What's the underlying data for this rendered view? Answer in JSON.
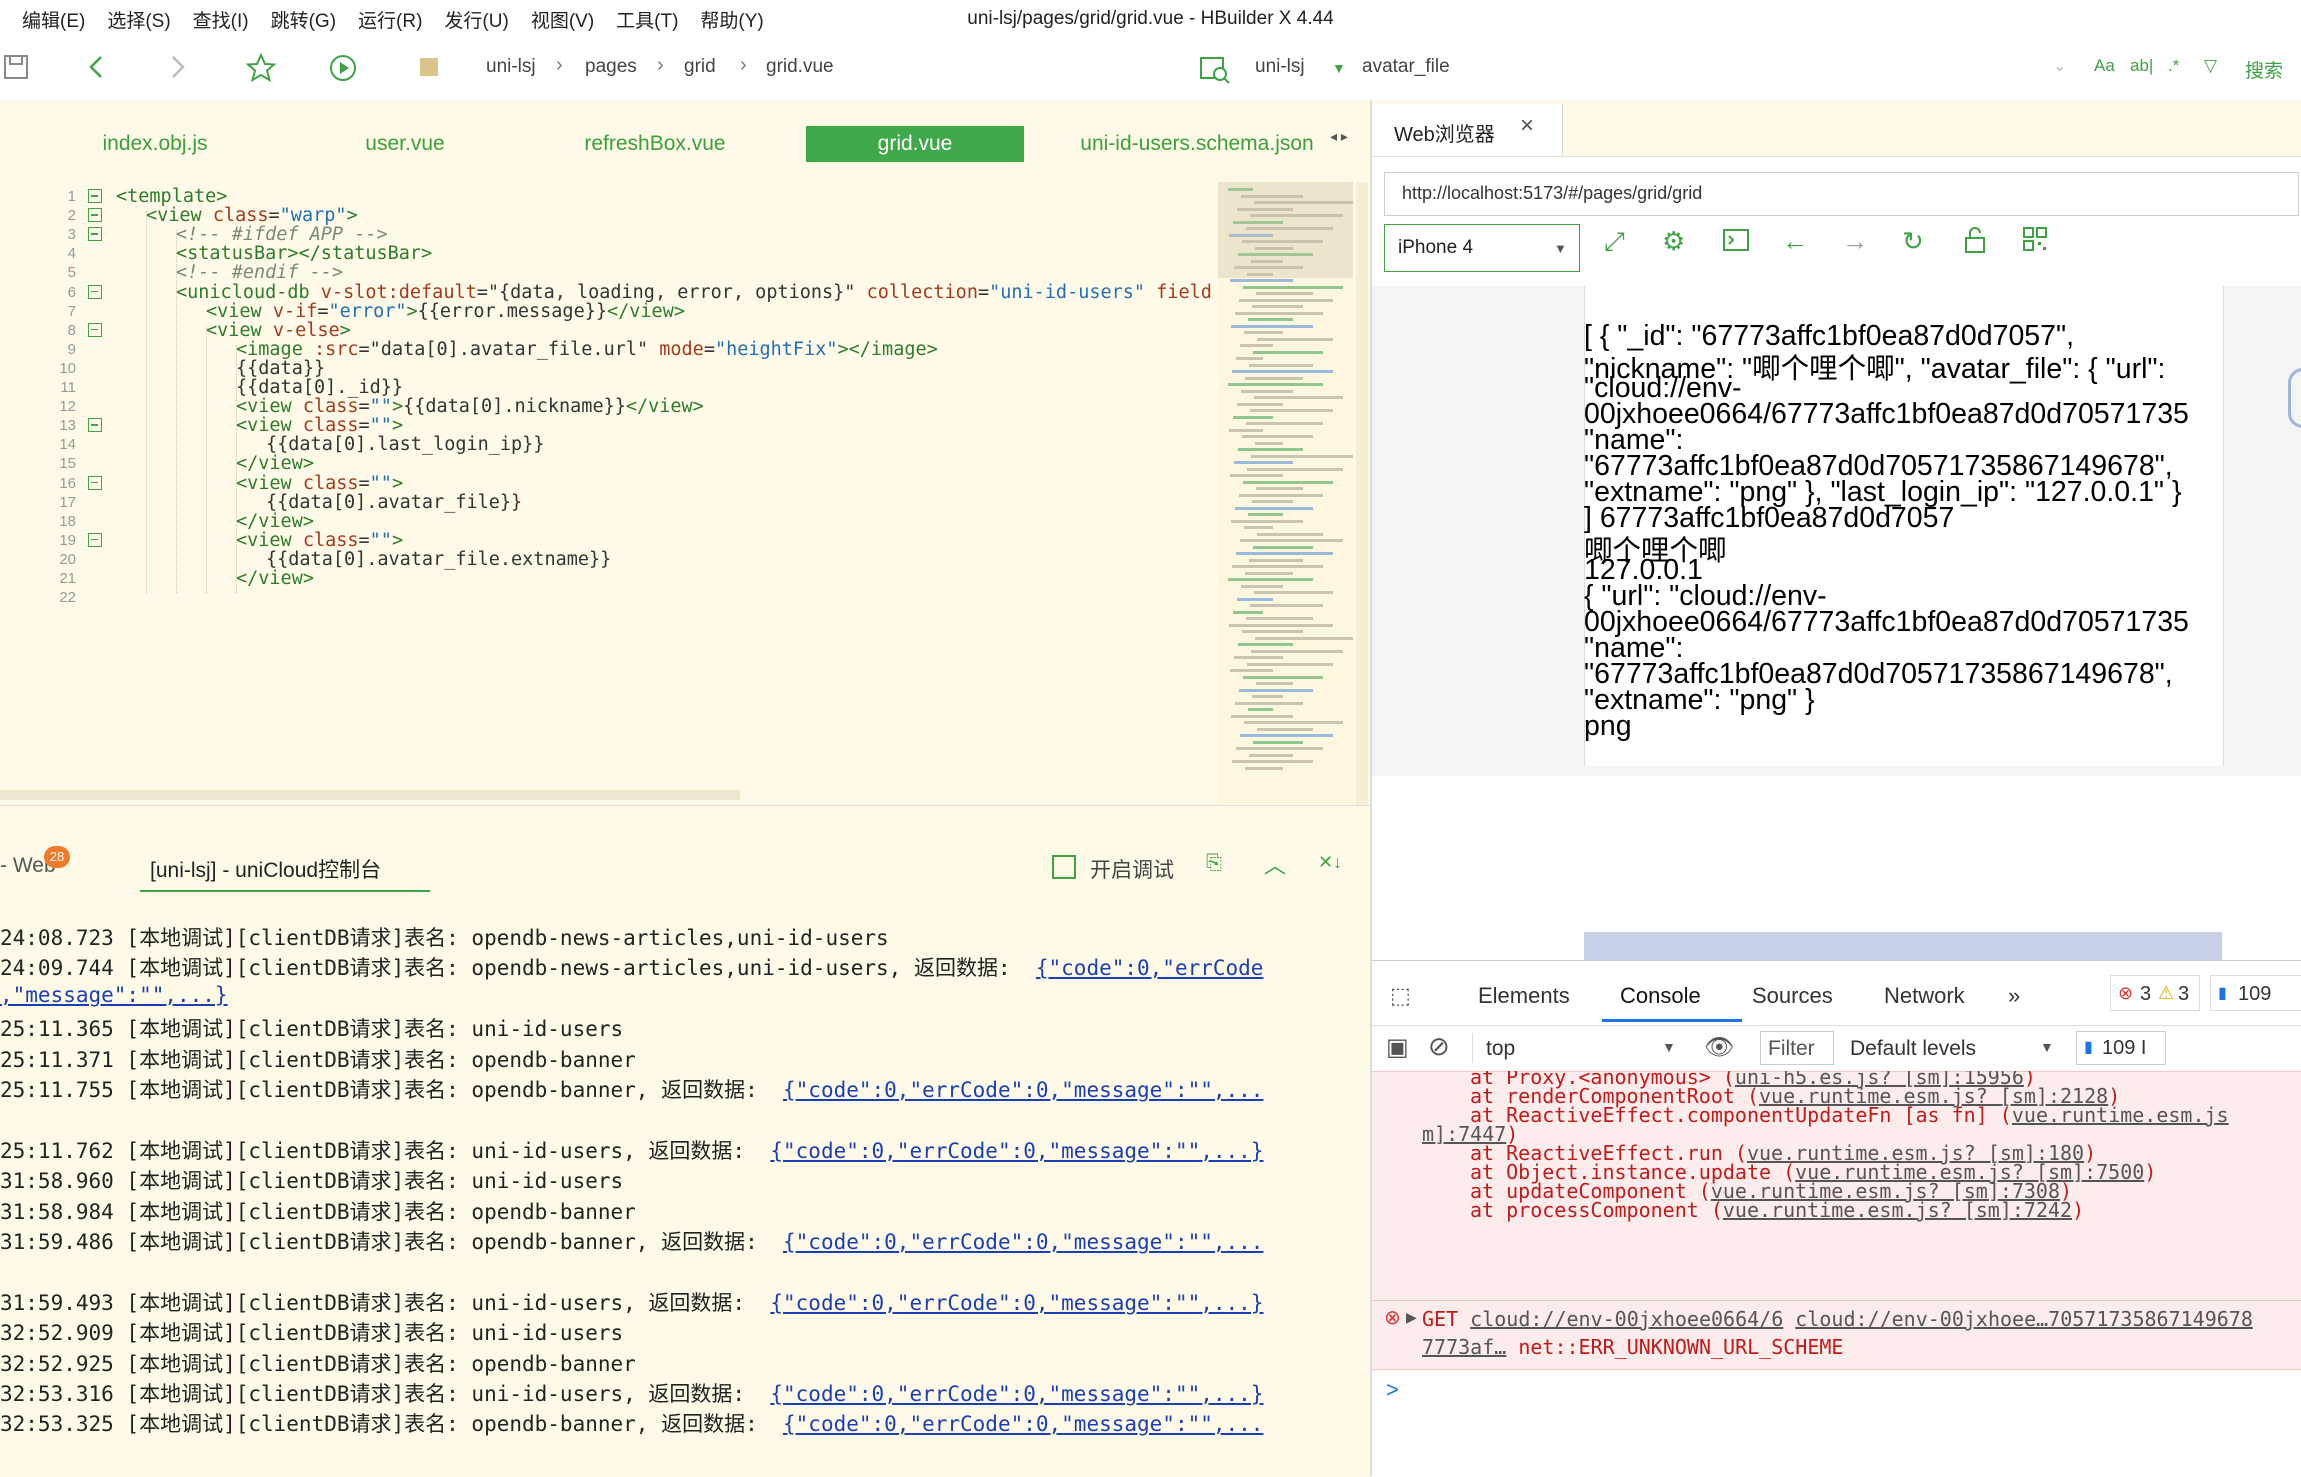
{
  "menubar": {
    "items": [
      "编辑(E)",
      "选择(S)",
      "查找(I)",
      "跳转(G)",
      "运行(R)",
      "发行(U)",
      "视图(V)",
      "工具(T)",
      "帮助(Y)"
    ],
    "title": "uni-lsj/pages/grid/grid.vue - HBuilder X 4.44"
  },
  "toolbar": {
    "breadcrumb": [
      "uni-lsj",
      "pages",
      "grid",
      "grid.vue"
    ],
    "project": "uni-lsj",
    "field": "avatar_file",
    "search_label": "搜索",
    "search_tools": [
      "Aa",
      "ab|",
      ".*"
    ]
  },
  "editor": {
    "tabs": [
      "index.obj.js",
      "user.vue",
      "refreshBox.vue",
      "grid.vue",
      "uni-id-users.schema.json"
    ],
    "active_tab": "grid.vue",
    "lines": [
      [
        [
          "tag",
          "<template>"
        ]
      ],
      [
        [
          "tag",
          "<view "
        ],
        [
          "attr",
          "class"
        ],
        [
          "txt",
          "="
        ],
        [
          "str",
          "\"warp\""
        ],
        [
          "tag",
          ">"
        ]
      ],
      [
        [
          "cmt",
          "<!-- #ifdef APP -->"
        ]
      ],
      [
        [
          "tag",
          "<statusBar></statusBar>"
        ]
      ],
      [
        [
          "cmt",
          "<!-- #endif -->"
        ]
      ],
      [
        [
          "tag",
          "<unicloud-db "
        ],
        [
          "attr",
          "v-slot:default"
        ],
        [
          "txt",
          "="
        ],
        [
          "txt",
          "\"{data, loading, error, options}\" "
        ],
        [
          "attr",
          "collection"
        ],
        [
          "txt",
          "="
        ],
        [
          "str",
          "\"uni-id-users\" "
        ],
        [
          "attr",
          "field"
        ]
      ],
      [
        [
          "tag",
          "<view "
        ],
        [
          "attr",
          "v-if"
        ],
        [
          "txt",
          "="
        ],
        [
          "str",
          "\"error\""
        ],
        [
          "tag",
          ">"
        ],
        [
          "txt",
          "{{error.message}}"
        ],
        [
          "tag",
          "</view>"
        ]
      ],
      [
        [
          "tag",
          "<view "
        ],
        [
          "attr",
          "v-else"
        ],
        [
          "tag",
          ">"
        ]
      ],
      [
        [
          "tag",
          "<image "
        ],
        [
          "attr",
          ":src"
        ],
        [
          "txt",
          "=\"data[0].avatar_file.url\" "
        ],
        [
          "attr",
          "mode"
        ],
        [
          "txt",
          "="
        ],
        [
          "str",
          "\"heightFix\""
        ],
        [
          "tag",
          "></image>"
        ]
      ],
      [
        [
          "txt",
          "{{data}}"
        ]
      ],
      [
        [
          "txt",
          "{{data[0]._id}}"
        ]
      ],
      [
        [
          "tag",
          "<view "
        ],
        [
          "attr",
          "class"
        ],
        [
          "txt",
          "="
        ],
        [
          "str",
          "\"\""
        ],
        [
          "tag",
          ">"
        ],
        [
          "txt",
          "{{data[0].nickname}}"
        ],
        [
          "tag",
          "</view>"
        ]
      ],
      [
        [
          "tag",
          "<view "
        ],
        [
          "attr",
          "class"
        ],
        [
          "txt",
          "="
        ],
        [
          "str",
          "\"\""
        ],
        [
          "tag",
          ">"
        ]
      ],
      [
        [
          "txt",
          "{{data[0].last_login_ip}}"
        ]
      ],
      [
        [
          "tag",
          "</view>"
        ]
      ],
      [
        [
          "tag",
          "<view "
        ],
        [
          "attr",
          "class"
        ],
        [
          "txt",
          "="
        ],
        [
          "str",
          "\"\""
        ],
        [
          "tag",
          ">"
        ]
      ],
      [
        [
          "txt",
          "{{data[0].avatar_file}}"
        ]
      ],
      [
        [
          "tag",
          "</view>"
        ]
      ],
      [
        [
          "tag",
          "<view "
        ],
        [
          "attr",
          "class"
        ],
        [
          "txt",
          "="
        ],
        [
          "str",
          "\"\""
        ],
        [
          "tag",
          ">"
        ]
      ],
      [
        [
          "txt",
          "{{data[0].avatar_file.extname}}"
        ]
      ],
      [
        [
          "tag",
          "</view>"
        ]
      ],
      []
    ],
    "indents": [
      0,
      1,
      2,
      2,
      2,
      2,
      3,
      3,
      4,
      4,
      4,
      4,
      4,
      5,
      4,
      4,
      5,
      4,
      4,
      5,
      4,
      0
    ],
    "fold_lines": [
      1,
      2,
      3,
      6,
      8,
      13,
      16,
      19
    ],
    "line_numbers": [
      "1",
      "2",
      "3",
      "4",
      "5",
      "6",
      "7",
      "8",
      "9",
      "10",
      "11",
      "12",
      "13",
      "14",
      "15",
      "16",
      "17",
      "18",
      "19",
      "20",
      "21",
      "22"
    ]
  },
  "console": {
    "tab_web": "- Web",
    "badge": "28",
    "tab_active": "[uni-lsj] - uniCloud控制台",
    "debug_label": "开启调试",
    "logs": [
      {
        "text": "24:08.723 [本地调试][clientDB请求]表名: opendb-news-articles,uni-id-users",
        "link": ""
      },
      {
        "text": "24:09.744 [本地调试][clientDB请求]表名: opendb-news-articles,uni-id-users, 返回数据:  ",
        "link": "{\"code\":0,\"errCode"
      },
      {
        "text": "",
        "link": ",\"message\":\"\",...}"
      },
      {
        "text": "25:11.365 [本地调试][clientDB请求]表名: uni-id-users",
        "link": ""
      },
      {
        "text": "25:11.371 [本地调试][clientDB请求]表名: opendb-banner",
        "link": ""
      },
      {
        "text": "25:11.755 [本地调试][clientDB请求]表名: opendb-banner, 返回数据:  ",
        "link": "{\"code\":0,\"errCode\":0,\"message\":\"\",..."
      },
      {
        "text": "",
        "link": ""
      },
      {
        "text": "25:11.762 [本地调试][clientDB请求]表名: uni-id-users, 返回数据:  ",
        "link": "{\"code\":0,\"errCode\":0,\"message\":\"\",...}"
      },
      {
        "text": "31:58.960 [本地调试][clientDB请求]表名: uni-id-users",
        "link": ""
      },
      {
        "text": "31:58.984 [本地调试][clientDB请求]表名: opendb-banner",
        "link": ""
      },
      {
        "text": "31:59.486 [本地调试][clientDB请求]表名: opendb-banner, 返回数据:  ",
        "link": "{\"code\":0,\"errCode\":0,\"message\":\"\",..."
      },
      {
        "text": "",
        "link": ""
      },
      {
        "text": "31:59.493 [本地调试][clientDB请求]表名: uni-id-users, 返回数据:  ",
        "link": "{\"code\":0,\"errCode\":0,\"message\":\"\",...}"
      },
      {
        "text": "32:52.909 [本地调试][clientDB请求]表名: uni-id-users",
        "link": ""
      },
      {
        "text": "32:52.925 [本地调试][clientDB请求]表名: opendb-banner",
        "link": ""
      },
      {
        "text": "32:53.316 [本地调试][clientDB请求]表名: uni-id-users, 返回数据:  ",
        "link": "{\"code\":0,\"errCode\":0,\"message\":\"\",...}"
      },
      {
        "text": "32:53.325 [本地调试][clientDB请求]表名: opendb-banner, 返回数据:  ",
        "link": "{\"code\":0,\"errCode\":0,\"message\":\"\",..."
      }
    ]
  },
  "browser": {
    "tab_label": "Web浏览器",
    "url": "http://localhost:5173/#/pages/grid/grid",
    "device": "iPhone 4",
    "page_lines": [
      "[ { \"_id\": \"67773affc1bf0ea87d0d7057\",",
      "\"nickname\": \"唧个哩个唧\", \"avatar_file\": { \"url\":",
      "\"cloud://env-",
      "00jxhoee0664/67773affc1bf0ea87d0d70571735",
      "\"name\":",
      "\"67773affc1bf0ea87d0d70571735867149678\",",
      "\"extname\": \"png\" }, \"last_login_ip\": \"127.0.0.1\" }",
      "] 67773affc1bf0ea87d0d7057",
      "唧个哩个唧",
      "127.0.0.1",
      "{ \"url\": \"cloud://env-",
      "00jxhoee0664/67773affc1bf0ea87d0d70571735",
      "\"name\":",
      "\"67773affc1bf0ea87d0d70571735867149678\",",
      "\"extname\": \"png\" }",
      "png"
    ]
  },
  "devtools": {
    "tabs": [
      "Elements",
      "Console",
      "Sources",
      "Network"
    ],
    "active_tab": "Console",
    "errors_count": "3",
    "warnings_count": "3",
    "messages_count": "109",
    "context": "top",
    "filter_placeholder": "Filter",
    "levels": "Default levels",
    "issues_count": "109 I",
    "stack": [
      {
        "prefix": "at Proxy.<anonymous> (",
        "link": "uni-h5.es.js? [sm]:15956",
        "suffix": ")"
      },
      {
        "prefix": "at renderComponentRoot (",
        "link": "vue.runtime.esm.js? [sm]:2128",
        "suffix": ")"
      },
      {
        "prefix": "at ReactiveEffect.componentUpdateFn [as fn] (",
        "link": "vue.runtime.esm.js",
        "suffix": ""
      },
      {
        "prefix": "",
        "link": "m]:7447",
        "suffix": ")"
      },
      {
        "prefix": "at ReactiveEffect.run (",
        "link": "vue.runtime.esm.js? [sm]:180",
        "suffix": ")"
      },
      {
        "prefix": "at Object.instance.update (",
        "link": "vue.runtime.esm.js? [sm]:7500",
        "suffix": ")"
      },
      {
        "prefix": "at updateComponent (",
        "link": "vue.runtime.esm.js? [sm]:7308",
        "suffix": ")"
      },
      {
        "prefix": "at processComponent (",
        "link": "vue.runtime.esm.js? [sm]:7242",
        "suffix": ")"
      }
    ],
    "error2_line1_prefix": "GET ",
    "error2_line1_link1": "cloud://env-00jxhoee0664/6",
    "error2_line1_link2": "cloud://env-00jxhoee…70571735867149678",
    "error2_line2_link": "7773af…",
    "error2_line2_text": " net::ERR_UNKNOWN_URL_SCHEME",
    "prompt": ">"
  }
}
